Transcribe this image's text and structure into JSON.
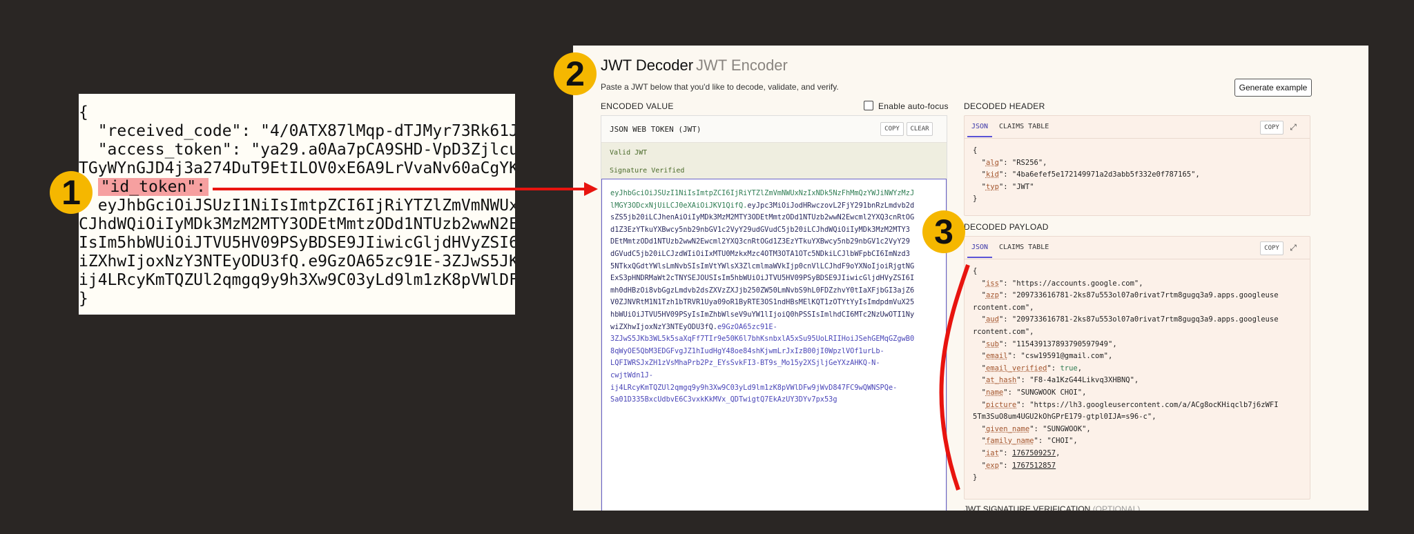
{
  "json_panel": {
    "lines": [
      "{",
      "  \"received_code\": \"4/0ATX87lMqp-dTJMyr73Rk61J",
      "  \"access_token\": \"ya29.a0Aa7pCA9SHD-VpD3Zjlcu",
      "TGyWYnGJD4j3a274DuT9EtILOV0xE6A9LrVvaNv60aCgYK",
      "  ",
      "  eyJhbGciOiJSUzI1NiIsImtpZCI6IjRiYTZlZmVmNWUxN",
      "CJhdWQiOiIyMDk3MzM2MTY3ODEtMmtzODd1NTUzb2wwN2E",
      "IsIm5hbWUiOiJTVU5HV09PSyBDSE9JIiwicGljdHVyZSI6",
      "iZXhwIjoxNzY3NTEyODU3fQ.e9GzOA65zc91E-3ZJwS5JK",
      "ij4LRcyKmTQZUl2qmgq9y9h3Xw9C03yLd9lm1zK8pVWlDF",
      "}"
    ],
    "id_token_key": "\"id_token\":"
  },
  "badges": [
    "1",
    "2",
    "3"
  ],
  "app": {
    "tab_decoder": "JWT Decoder",
    "tab_encoder": "JWT Encoder",
    "subtitle": "Paste a JWT below that you'd like to decode, validate, and verify.",
    "generate_example": "Generate example",
    "encoded_value_label": "ENCODED VALUE",
    "auto_focus_label": "Enable auto-focus",
    "encoded_card_title": "JSON WEB TOKEN (JWT)",
    "copy_label": "COPY",
    "clear_label": "CLEAR",
    "valid_jwt": "Valid JWT",
    "signature_verified": "Signature Verified",
    "token_header_lines": [
      "eyJhbGciOiJSUzI1NiIsImtpZCI6IjRiYTZlZmVmNWUxNzIxNDk5NzFhMmQzYWJiNWYzMzJ",
      "lMGY3ODcxNjUiLCJ0eXAiOiJKV1QifQ."
    ],
    "token_payload_lines": [
      "eyJpc3MiOiJodHRwczovL2FjY291bnRzLmdvb2d",
      "sZS5jb20iLCJhenAiOiIyMDk3MzM2MTY3ODEtMmtzODd1NTUzb2wwN2Ewcml2YXQ3cnRtOG",
      "d1Z3EzYTkuYXBwcy5nb29nbGV1c2VyY29udGVudC5jb20iLCJhdWQiOiIyMDk3MzM2MTY3",
      "DEtMmtzODd1NTUzb2wwN2Ewcml2YXQ3cnRtOGd1Z3EzYTkuYXBwcy5nb29nbGV1c2VyY29",
      "dGVudC5jb20iLCJzdWIiOiIxMTU0MzkxMzc4OTM3OTA1OTc5NDkiLCJlbWFpbCI6ImNzd3",
      "5NTkxQGdtYWlsLmNvbSIsImVtYWlsX3ZlcmlmaWVkIjp0cnVlLCJhdF9oYXNoIjoiRjgtNG",
      "ExS3pHNDRMaWt2cTNYSEJOUSIsIm5hbWUiOiJTVU5HV09PSyBDSE9JIiwicGljdHVyZSI6I",
      "mh0dHBzOi8vbGgzLmdvb2dsZXVzZXJjb250ZW50LmNvbS9hL0FDZzhvY0tIaXFjbGI3ajZ6",
      "V0ZJNVRtM1N1Tzh1bTRVR1Uya09oR1ByRTE3OS1ndHBsMElKQT1zOTYtYyIsImdpdmVuX25",
      "hbWUiOiJTVU5HV09PSyIsImZhbWlseV9uYW1lIjoiQ0hPSSIsImlhdCI6MTc2NzUwOTI1Ny",
      "wiZXhwIjoxNzY3NTEyODU3fQ."
    ],
    "token_signature_lines": [
      "e9GzOA65zc91E-",
      "3ZJwS5JKb3WL5k5saXqFf7TIr9e50K6l7bhKsnbxlA5xSu95UoLRIIHoiJSehGEMqGZgwB0",
      "8qWyOE5QbM3EDGFvgJZ1hIudHgY48oe84shKjwmLrJxIzB00jI0WpzlVOf1urLb-",
      "LQFIWRSJxZH1zVsMhaPrb2Pz_EYsSvkFI3-BT9s_Mo15y2XSjljGeYXzAHKQ-N-",
      "cwjtWdn1J-",
      "ij4LRcyKmTQZUl2qmgq9y9h3Xw9C03yLd9lm1zK8pVWlDFw9jWvD847FC9wQWNSPQe-",
      "Sa01D335BxcUdbvE6C3vxkKkMVx_QDTwigtQ7EkAzUY3DYv7px53g"
    ],
    "decoded_header_label": "DECODED HEADER",
    "decoded_payload_label": "DECODED PAYLOAD",
    "tab_json": "JSON",
    "tab_claims_table": "CLAIMS TABLE",
    "header_json": {
      "alg": "RS256",
      "kid": "4ba6efef5e172149971a2d3abb5f332e0f787165",
      "typ": "JWT"
    },
    "payload_json": {
      "iss": "https://accounts.google.com",
      "azp_1": "209733616781-2ks87u553ol07a0rivat7rtm8gugq3a9.apps.googleuse",
      "azp_2": "rcontent.com",
      "aud_1": "209733616781-2ks87u553ol07a0rivat7rtm8gugq3a9.apps.googleuse",
      "aud_2": "rcontent.com",
      "sub": "115439137893790597949",
      "email": "csw19591@gmail.com",
      "email_verified": "true",
      "at_hash": "F8-4a1KzG44Likvq3XHBNQ",
      "name": "SUNGWOOK CHOI",
      "picture_1": "https://lh3.googleusercontent.com/a/ACg8ocKHiqclb7j6zWFI",
      "picture_2": "5Tm3SuO8um4UGU2kOhGPrE179-gtpl0IJA=s96-c",
      "given_name": "SUNGWOOK",
      "family_name": "CHOI",
      "iat": "1767509257",
      "exp": "1767512857"
    },
    "signature_label": "JWT SIGNATURE VERIFICATION",
    "signature_optional": "(OPTIONAL)"
  },
  "colors": {
    "background": "#2a2624",
    "badge": "#f5b700",
    "annotation_red": "#e8140f",
    "accent": "#5a52d6"
  },
  "icons": [
    "checkbox-icon",
    "expand-icon",
    "arrow-icon"
  ]
}
